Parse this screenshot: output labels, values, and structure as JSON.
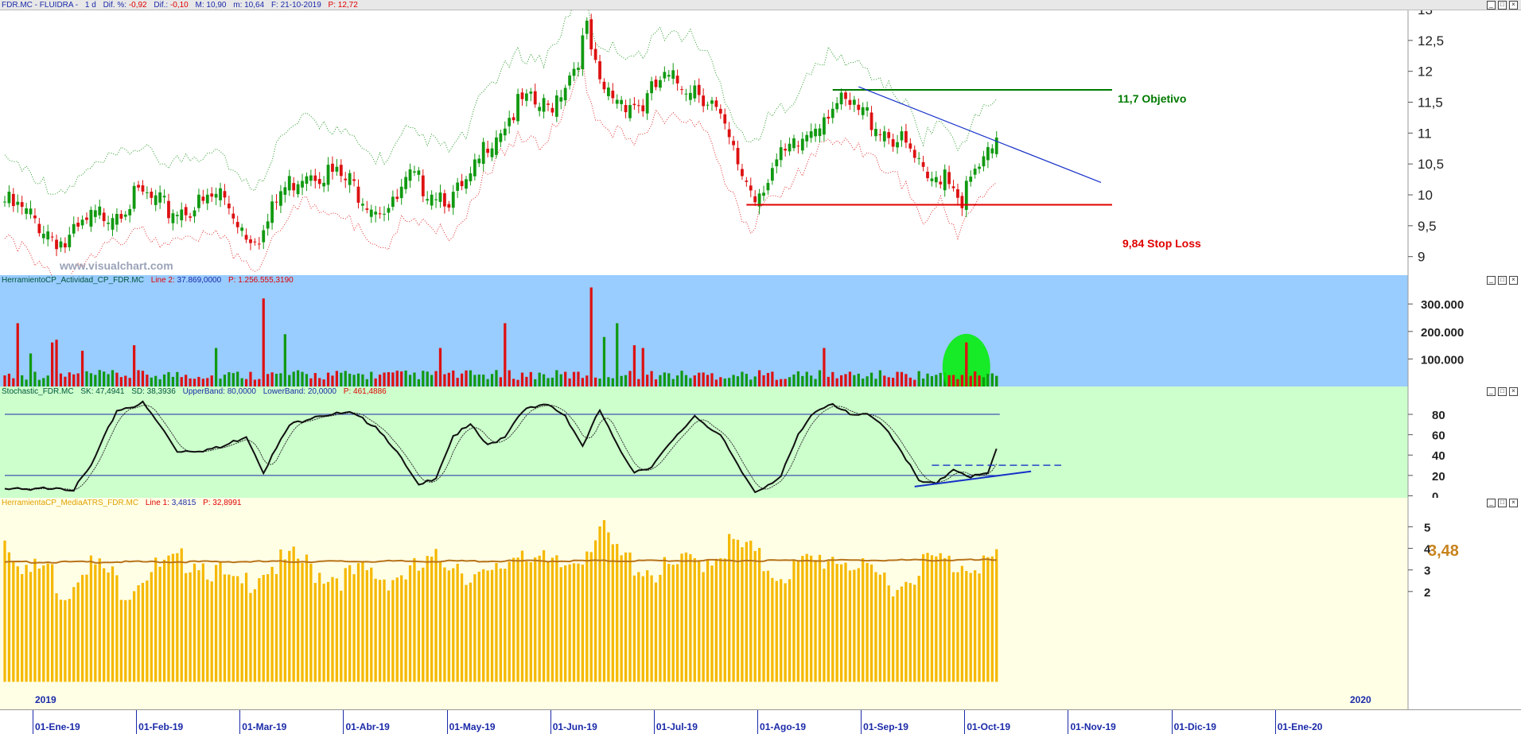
{
  "main_header": {
    "symbol": "FDR.MC - FLUIDRA -",
    "tf": "1 d",
    "dif_pct_label": "Dif. %:",
    "dif_pct": "-0,92",
    "dif_label": "Dif.:",
    "dif": "-0,10",
    "max_label": "M:",
    "max": "10,90",
    "min_label": "m:",
    "min": "10,64",
    "date_label": "F:",
    "date": "21-10-2019",
    "p_label": "P:",
    "p": "12,72"
  },
  "watermark": "www.visualchart.com",
  "annotations": {
    "target": "11,7 Objetivo",
    "stop": "9,84 Stop Loss",
    "target_color": "#007a00",
    "stop_color": "#e00000"
  },
  "volume_header": {
    "name": "HerramientoCP_Actividad_CP_FDR.MC",
    "line_label": "Line 2:",
    "line": "37.869,0000",
    "p_label": "P:",
    "p": "1.256.555,3190"
  },
  "stoch_header": {
    "name": "Stochastic_FDR.MC",
    "sk_label": "SK:",
    "sk": "47,4941",
    "sd_label": "SD:",
    "sd": "38,3936",
    "ub_label": "UpperBand:",
    "ub": "80,0000",
    "lb_label": "LowerBand:",
    "lb": "20,0000",
    "p_label": "P:",
    "p": "461,4886"
  },
  "atr_header": {
    "name": "HerramientaCP_MediaATRS_FDR.MC",
    "line_label": "Line 1:",
    "line": "3,4815",
    "p_label": "P:",
    "p": "32,8991"
  },
  "atr_last": "3,48",
  "years": {
    "y2019": "2019",
    "y2020": "2020"
  },
  "colors": {
    "up": "#119911",
    "down": "#dd1111",
    "upper_env": "#2a9a2a",
    "lower_env": "#e03030",
    "trend": "#1530c8",
    "vol_bg": "#99ccff",
    "stoch_bg": "#ccffcc",
    "atr_bg": "#ffffe6",
    "atr_bar": "#f5b800",
    "atr_line": "#b8731a"
  },
  "chart_data": [
    {
      "type": "candlestick",
      "title": "FDR.MC - FLUIDRA",
      "x_labels": [
        "01-Ene-19",
        "01-Feb-19",
        "01-Mar-19",
        "01-Abr-19",
        "01-May-19",
        "01-Jun-19",
        "01-Jul-19",
        "01-Ago-19",
        "01-Sep-19",
        "01-Oct-19",
        "01-Nov-19",
        "01-Dic-19",
        "01-Ene-20"
      ],
      "y_ticks": [
        "9",
        "9,5",
        "10",
        "10,5",
        "11",
        "11,5",
        "12",
        "12,5",
        "13"
      ],
      "ylim": [
        8.7,
        13
      ],
      "close_knots": [
        [
          0,
          10.0
        ],
        [
          6,
          9.75
        ],
        [
          14,
          9.3
        ],
        [
          20,
          9.7
        ],
        [
          24,
          9.85
        ],
        [
          32,
          10.1
        ],
        [
          38,
          9.85
        ],
        [
          46,
          9.95
        ],
        [
          50,
          10.15
        ],
        [
          56,
          9.5
        ],
        [
          60,
          9.5
        ],
        [
          64,
          10.15
        ],
        [
          70,
          10.55
        ],
        [
          76,
          10.45
        ],
        [
          80,
          10.3
        ],
        [
          86,
          9.95
        ],
        [
          90,
          9.9
        ],
        [
          94,
          10.35
        ],
        [
          100,
          10.2
        ],
        [
          104,
          10.05
        ],
        [
          108,
          10.3
        ],
        [
          112,
          11.0
        ],
        [
          120,
          11.6
        ],
        [
          126,
          11.5
        ],
        [
          132,
          12.2
        ],
        [
          135,
          12.75
        ],
        [
          138,
          11.8
        ],
        [
          142,
          11.7
        ],
        [
          148,
          11.55
        ],
        [
          152,
          11.95
        ],
        [
          160,
          11.9
        ],
        [
          164,
          11.6
        ],
        [
          170,
          10.6
        ],
        [
          174,
          10.1
        ],
        [
          178,
          10.55
        ],
        [
          184,
          10.9
        ],
        [
          188,
          11.3
        ],
        [
          192,
          11.6
        ],
        [
          196,
          11.5
        ],
        [
          200,
          11.4
        ],
        [
          206,
          11.05
        ],
        [
          210,
          10.8
        ],
        [
          214,
          10.25
        ],
        [
          218,
          10.55
        ],
        [
          222,
          10.05
        ],
        [
          226,
          10.55
        ],
        [
          230,
          10.85
        ]
      ],
      "last_bar": 230,
      "x_domain": [
        0,
        320
      ],
      "annotations": [
        {
          "price": 11.7,
          "label": "11,7 Objetivo"
        },
        {
          "price": 9.84,
          "label": "9,84 Stop Loss"
        }
      ]
    },
    {
      "type": "bar",
      "title": "HerramientoCP_Actividad_CP_FDR.MC",
      "y_ticks": [
        "100.000",
        "200.000",
        "300.000"
      ],
      "ylim": [
        0,
        370000
      ],
      "base_volume": 40000,
      "spikes": [
        [
          3,
          230000
        ],
        [
          6,
          120000
        ],
        [
          11,
          160000
        ],
        [
          12,
          170000
        ],
        [
          18,
          130000
        ],
        [
          30,
          150000
        ],
        [
          49,
          140000
        ],
        [
          60,
          320000
        ],
        [
          65,
          190000
        ],
        [
          101,
          140000
        ],
        [
          116,
          230000
        ],
        [
          136,
          360000
        ],
        [
          139,
          180000
        ],
        [
          142,
          230000
        ],
        [
          146,
          150000
        ],
        [
          148,
          140000
        ],
        [
          190,
          140000
        ],
        [
          223,
          160000
        ]
      ]
    },
    {
      "type": "line",
      "title": "Stochastic_FDR.MC",
      "y_ticks": [
        "0",
        "20",
        "40",
        "60",
        "80"
      ],
      "ylim": [
        -2,
        98
      ],
      "upper_band": 80,
      "lower_band": 20,
      "sk_knots": [
        [
          0,
          8
        ],
        [
          6,
          6
        ],
        [
          12,
          10
        ],
        [
          16,
          7
        ],
        [
          20,
          30
        ],
        [
          26,
          85
        ],
        [
          32,
          92
        ],
        [
          36,
          70
        ],
        [
          40,
          45
        ],
        [
          46,
          46
        ],
        [
          50,
          48
        ],
        [
          56,
          60
        ],
        [
          60,
          25
        ],
        [
          66,
          70
        ],
        [
          72,
          80
        ],
        [
          80,
          82
        ],
        [
          86,
          70
        ],
        [
          90,
          50
        ],
        [
          96,
          10
        ],
        [
          100,
          20
        ],
        [
          104,
          60
        ],
        [
          108,
          70
        ],
        [
          112,
          50
        ],
        [
          116,
          60
        ],
        [
          120,
          85
        ],
        [
          126,
          90
        ],
        [
          130,
          80
        ],
        [
          134,
          50
        ],
        [
          138,
          85
        ],
        [
          142,
          50
        ],
        [
          146,
          25
        ],
        [
          150,
          30
        ],
        [
          154,
          50
        ],
        [
          160,
          80
        ],
        [
          166,
          60
        ],
        [
          170,
          30
        ],
        [
          174,
          5
        ],
        [
          180,
          20
        ],
        [
          184,
          60
        ],
        [
          188,
          85
        ],
        [
          192,
          92
        ],
        [
          196,
          80
        ],
        [
          200,
          80
        ],
        [
          204,
          70
        ],
        [
          208,
          45
        ],
        [
          212,
          15
        ],
        [
          216,
          12
        ],
        [
          220,
          28
        ],
        [
          224,
          20
        ],
        [
          228,
          22
        ],
        [
          230,
          47
        ]
      ],
      "series": [
        {
          "name": "SK",
          "last": "47,4941"
        },
        {
          "name": "SD",
          "last": "38,3936"
        }
      ]
    },
    {
      "type": "bar",
      "title": "HerramientaCP_MediaATRS_FDR.MC",
      "y_ticks": [
        "2",
        "3",
        "4",
        "5"
      ],
      "ylim": [
        1.5,
        5.9
      ],
      "avg_level": 3.48,
      "atr_knots": [
        [
          0,
          4.8
        ],
        [
          6,
          3.2
        ],
        [
          10,
          3.6
        ],
        [
          14,
          2.0
        ],
        [
          18,
          3.8
        ],
        [
          24,
          3.2
        ],
        [
          28,
          2.4
        ],
        [
          32,
          3.2
        ],
        [
          40,
          3.6
        ],
        [
          44,
          4.0
        ],
        [
          48,
          3.4
        ],
        [
          54,
          2.4
        ],
        [
          60,
          3.5
        ],
        [
          64,
          3.6
        ],
        [
          68,
          3.8
        ],
        [
          72,
          3.3
        ],
        [
          80,
          3.0
        ],
        [
          84,
          3.2
        ],
        [
          88,
          3.0
        ],
        [
          96,
          3.3
        ],
        [
          100,
          3.7
        ],
        [
          104,
          3.9
        ],
        [
          108,
          3.1
        ],
        [
          112,
          2.8
        ],
        [
          116,
          3.6
        ],
        [
          120,
          4.5
        ],
        [
          126,
          3.4
        ],
        [
          130,
          3.5
        ],
        [
          134,
          4.2
        ],
        [
          138,
          5.3
        ],
        [
          142,
          4.0
        ],
        [
          148,
          3.5
        ],
        [
          152,
          3.2
        ],
        [
          158,
          3.6
        ],
        [
          164,
          4.0
        ],
        [
          168,
          4.5
        ],
        [
          172,
          4.3
        ],
        [
          176,
          3.6
        ],
        [
          180,
          3.2
        ],
        [
          186,
          3.6
        ],
        [
          192,
          4.0
        ],
        [
          196,
          3.8
        ],
        [
          200,
          3.0
        ],
        [
          204,
          3.0
        ],
        [
          208,
          2.6
        ],
        [
          212,
          3.6
        ],
        [
          216,
          3.8
        ],
        [
          220,
          3.6
        ],
        [
          226,
          3.8
        ],
        [
          230,
          3.7
        ]
      ]
    }
  ]
}
